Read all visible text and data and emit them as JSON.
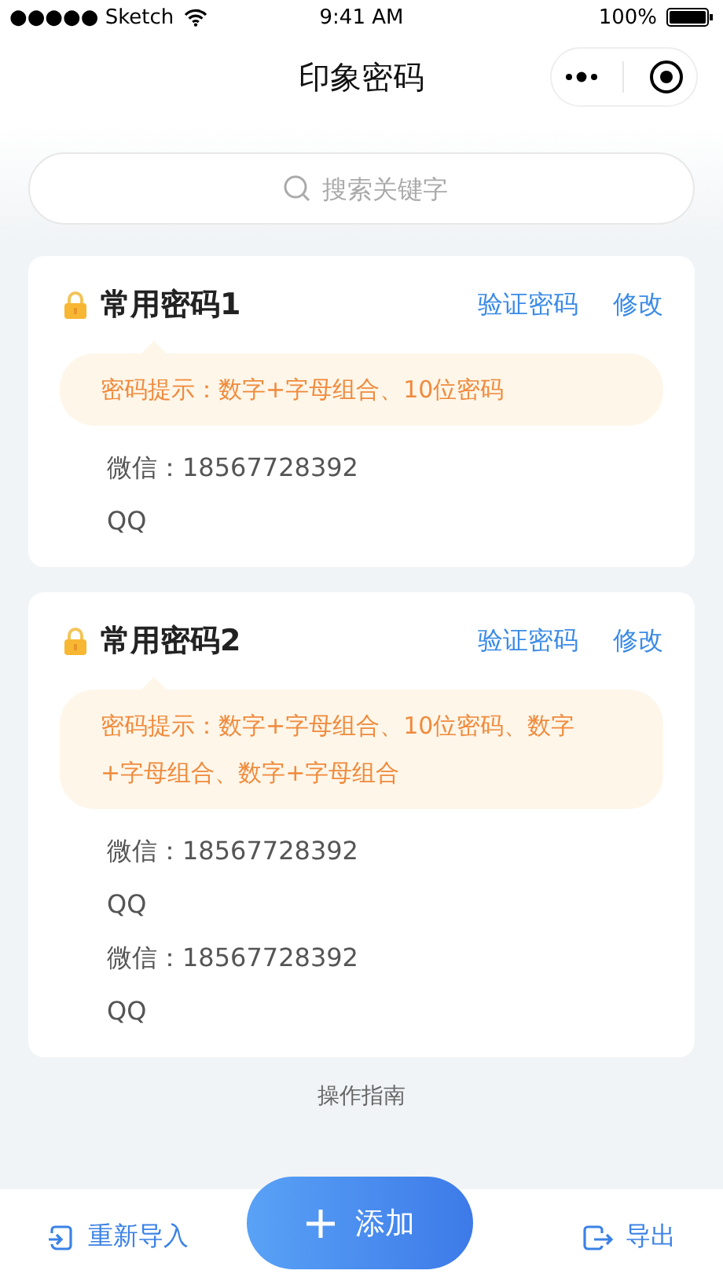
{
  "status_bar": {
    "carrier": "●●●●● Sketch",
    "time": "9:41 AM",
    "battery": "100%"
  },
  "nav": {
    "title": "印象密码"
  },
  "search": {
    "placeholder": "搜索关键字"
  },
  "cards": [
    {
      "title": "常用密码1",
      "actions": [
        "验证密码",
        "修改"
      ],
      "hint": "密码提示：数字+字母组合、10位密码",
      "entries": [
        "微信：18567728392",
        "QQ"
      ]
    },
    {
      "title": "常用密码2",
      "actions": [
        "验证密码",
        "修改"
      ],
      "hint": "密码提示：数字+字母组合、10位密码、数字+字母组合、数字+字母组合",
      "entries": [
        "微信：18567728392",
        "QQ",
        "微信：18567728392",
        "QQ"
      ]
    }
  ],
  "guide": "操作指南",
  "bottom_bar": {
    "left": "重新导入",
    "add": "添加",
    "right": "导出"
  }
}
